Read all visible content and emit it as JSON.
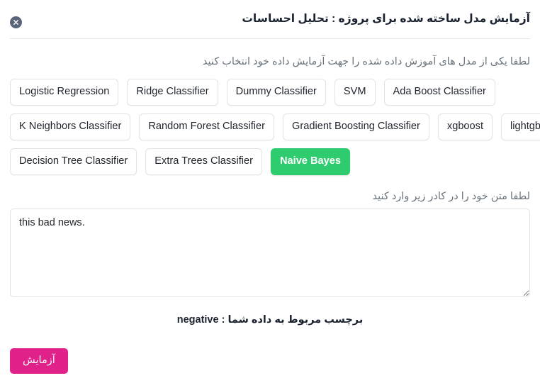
{
  "header": {
    "title": "آزمایش مدل ساخته شده برای پروژه : تحلیل احساسات",
    "close_icon": "close-x-icon"
  },
  "instructions": {
    "model_hint": "لطفا یکی از مدل های آموزش داده شده را جهت آزمایش داده خود انتخاب کنید",
    "text_hint": "لطفا متن خود را در کادر زیر وارد کنید"
  },
  "models": {
    "rows": [
      [
        {
          "label": "Logistic Regression",
          "selected": false
        },
        {
          "label": "Ridge Classifier",
          "selected": false
        },
        {
          "label": "Dummy Classifier",
          "selected": false
        },
        {
          "label": "SVM",
          "selected": false
        },
        {
          "label": "Ada Boost Classifier",
          "selected": false
        }
      ],
      [
        {
          "label": "K Neighbors Classifier",
          "selected": false
        },
        {
          "label": "Random Forest Classifier",
          "selected": false
        },
        {
          "label": "Gradient Boosting Classifier",
          "selected": false
        },
        {
          "label": "xgboost",
          "selected": false
        },
        {
          "label": "lightgbm",
          "selected": false
        }
      ],
      [
        {
          "label": "Decision Tree Classifier",
          "selected": false
        },
        {
          "label": "Extra Trees Classifier",
          "selected": false
        },
        {
          "label": "Naive Bayes",
          "selected": true
        }
      ]
    ]
  },
  "input": {
    "value": "this bad news.",
    "placeholder": ""
  },
  "result": {
    "label": "برچسب مربوط به داده شما : ",
    "value": "negative"
  },
  "footer": {
    "submit_label": "آزمایش"
  },
  "colors": {
    "selected_model": "#2ecc6f",
    "submit_button": "#e0218a",
    "close_button": "#5b6579",
    "hint_text": "#6c757d",
    "border": "#e3e3e3"
  }
}
